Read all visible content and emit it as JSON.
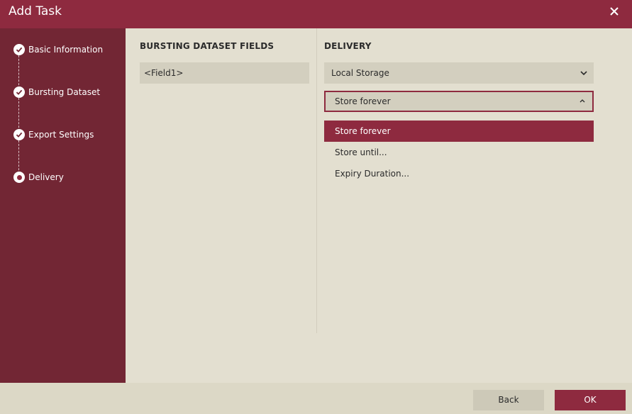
{
  "dialog": {
    "title": "Add Task",
    "close_icon": "close-icon"
  },
  "steps": [
    {
      "label": "Basic Information",
      "state": "completed",
      "icon": "check-icon"
    },
    {
      "label": "Bursting Dataset",
      "state": "completed",
      "icon": "check-icon"
    },
    {
      "label": "Export Settings",
      "state": "completed",
      "icon": "check-icon"
    },
    {
      "label": "Delivery",
      "state": "current",
      "icon": "radio-dot-icon"
    }
  ],
  "fields_panel": {
    "title": "BURSTING DATASET FIELDS",
    "items": [
      "<Field1>"
    ]
  },
  "delivery_panel": {
    "title": "DELIVERY",
    "destination_value": "Local Storage",
    "retention_value": "Store forever",
    "retention_options": [
      "Store forever",
      "Store until...",
      "Expiry Duration..."
    ],
    "selected_option": "Store forever"
  },
  "footer": {
    "back_label": "Back",
    "ok_label": "OK"
  },
  "colors": {
    "accent": "#8e2a3f",
    "sidebar": "#722634",
    "background": "#e3dfd0",
    "control": "#d3cfbf"
  }
}
